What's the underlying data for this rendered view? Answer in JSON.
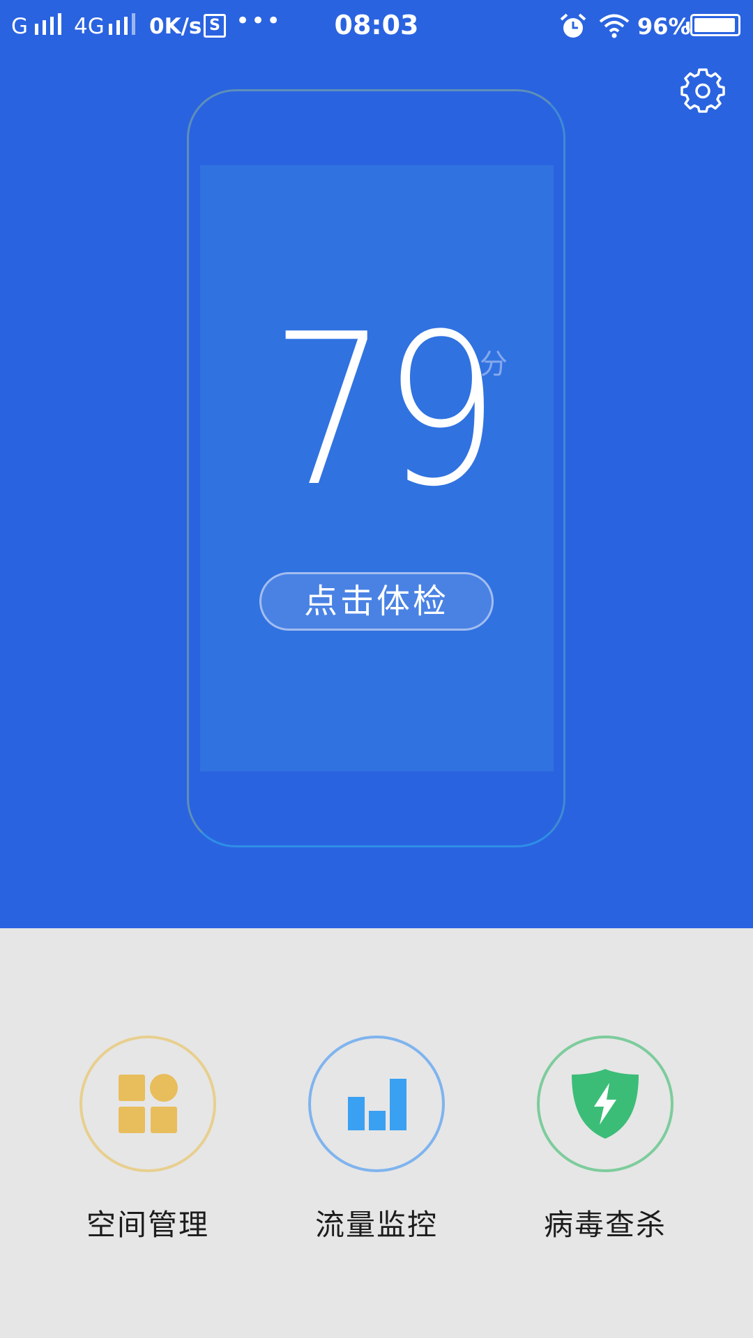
{
  "status_bar": {
    "carrier1": "G",
    "carrier2": "4G",
    "speed": "0K/s",
    "sim_icon": "S",
    "more": "•••",
    "time": "08:03",
    "battery": "96%"
  },
  "score": {
    "value": "79",
    "unit": "分"
  },
  "check_button": "点击体检",
  "tools": [
    {
      "label": "空间管理",
      "icon": "space-management-icon",
      "color": "#e8bd5c"
    },
    {
      "label": "流量监控",
      "icon": "traffic-monitor-icon",
      "color": "#3aa0f2"
    },
    {
      "label": "病毒查杀",
      "icon": "virus-scan-shield-icon",
      "color": "#3bbd77"
    }
  ],
  "colors": {
    "header_bg": "#2a63e0",
    "screen_bg": "#3072e0",
    "bottom_bg": "#e6e6e6"
  }
}
